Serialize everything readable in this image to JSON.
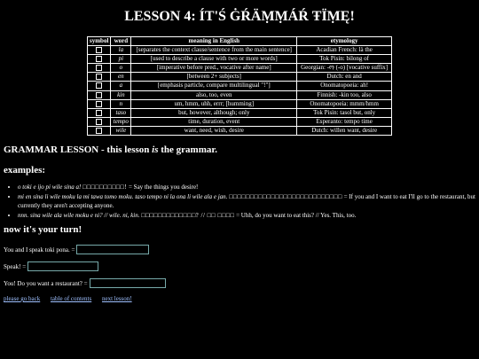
{
  "page": {
    "title": "LESSON 4: ÍT'Ś ĠŔÄṂṂÁŔ ŦÏṂĘ!"
  },
  "table": {
    "headers": [
      "symbol",
      "word",
      "meaning in English",
      "etymology"
    ],
    "rows": [
      {
        "word": "la",
        "meaning": "[separates the context clause/sentence from the main sentence]",
        "etymology": "Acadian French: là the"
      },
      {
        "word": "pi",
        "meaning": "[used to describe a clause with two or more words]",
        "etymology": "Tok Pisin: bilong of"
      },
      {
        "word": "o",
        "meaning": "[imperative before pred., vocative after name]",
        "etymology": "Georgian: -ო (-o) [vocative suffix]"
      },
      {
        "word": "en",
        "meaning": "[between 2+ subjects]",
        "etymology": "Dutch: en and"
      },
      {
        "word": "a",
        "meaning": "[emphasis particle, compare multilingual \"!\"]",
        "etymology": "Onomatopoeia: ah!"
      },
      {
        "word": "kin",
        "meaning": "also, too, even",
        "etymology": "Finnish: -kin too, also"
      },
      {
        "word": "n",
        "meaning": "um, hmm, uhh, errr; [humming]",
        "etymology": "Onomatopoeia: mmm/hmm"
      },
      {
        "word": "taso",
        "meaning": "but, however, although; only",
        "etymology": "Tok Pisin: tasol but, only"
      },
      {
        "word": "tempo",
        "meaning": "time, duration, event",
        "etymology": "Esperanto: tempo time"
      },
      {
        "word": "wile",
        "meaning": "want, need, wish, desire",
        "etymology": "Dutch: willen want, desire"
      }
    ]
  },
  "lesson": {
    "heading_prefix": "GRAMMAR LESSON - this lesson ",
    "heading_emph": "is",
    "heading_suffix": " the grammar.",
    "examples_heading": "examples:",
    "examples": [
      {
        "tp": "o toki e ijo pi wile sina a!",
        "glyphs": "□□□□□□□□□□!",
        "trans": " = Say the things you desire!"
      },
      {
        "tp": "mi en sina li wile moku la mi tawa tomo moku. taso tempo ni la ona li wile ala e jan.",
        "glyphs": "□□□□□□□□□□□□□□□□□□□□□□□□□□□",
        "trans": " = If you and I want to eat I'll go to the restaurant, but currently they aren't accepting anyone."
      },
      {
        "tp": "nnn. sina wile ala wile moku e ni? // wile. ni, kin.",
        "glyphs": "□□□□□□□□□□□□□?   //   □□   □□□□",
        "trans": " = Uhh, do you want to eat this? // Yes. This, too."
      }
    ]
  },
  "quiz": {
    "heading": "now it's your turn!",
    "questions": [
      {
        "label": "You and I speak toki pona. =",
        "value": ""
      },
      {
        "label": "Speak! =",
        "value": ""
      },
      {
        "label": "You! Do you want a restaurant? =",
        "value": ""
      }
    ]
  },
  "nav": {
    "links": [
      "please go back",
      "table of contents",
      "next lesson!"
    ]
  }
}
